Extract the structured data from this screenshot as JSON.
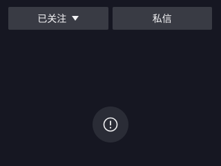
{
  "profile_actions": {
    "follow_label": "已关注",
    "message_label": "私信"
  },
  "colors": {
    "background": "#161722",
    "button_background": "#393b44",
    "text": "#f2f2f4",
    "bubble": "#2a2c36"
  },
  "icons": {
    "follow_dropdown": "caret-down-icon",
    "notice": "exclamation-circle-icon"
  }
}
